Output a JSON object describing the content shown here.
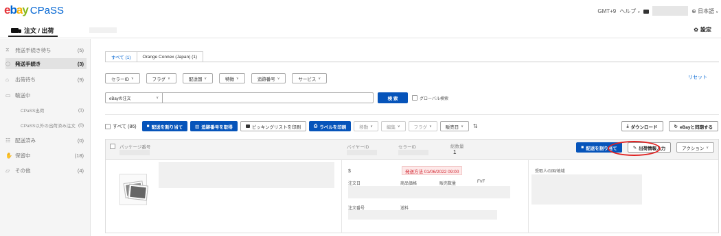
{
  "header": {
    "logo_letters": [
      "e",
      "b",
      "a",
      "y"
    ],
    "app_name": "CPaSS",
    "timezone": "GMT+9",
    "help": "ヘルプ",
    "language": "日本語"
  },
  "subheader": {
    "title": "注文 / 出荷",
    "settings": "設定"
  },
  "sidebar": {
    "items": [
      {
        "label": "発送手続き待ち",
        "count": "(5)",
        "icon": "hourglass-icon"
      },
      {
        "label": "発送手続き",
        "count": "(3)",
        "icon": "box-icon"
      },
      {
        "label": "出荷待ち",
        "count": "(9)",
        "icon": "warehouse-icon"
      },
      {
        "label": "輸送中",
        "count": "",
        "icon": "truck-icon"
      },
      {
        "label": "CPaSS出荷",
        "count": "(1)",
        "icon": ""
      },
      {
        "label": "CPaSS以外の出荷済み注文",
        "count": "(0)",
        "icon": ""
      },
      {
        "label": "配送済み",
        "count": "(0)",
        "icon": "delivered-icon"
      },
      {
        "label": "保留中",
        "count": "(18)",
        "icon": "hand-icon"
      },
      {
        "label": "その他",
        "count": "(4)",
        "icon": "folder-icon"
      }
    ]
  },
  "tabs": [
    {
      "label": "すべて (1)",
      "active": true
    },
    {
      "label": "Orange Connex (Japan) (1)",
      "active": false
    }
  ],
  "filters": [
    "セラーID",
    "フラグ",
    "配送国",
    "特徴",
    "追跡番号",
    "サービス"
  ],
  "reset": "リセット",
  "search": {
    "select_value": "eBayの注文",
    "button": "検 索",
    "global_label": "グローバル検索"
  },
  "actions": {
    "select_all": "すべて (86)",
    "assign_shipping": "配送を割り当て",
    "get_tracking": "追跡番号を取得",
    "print_picking": "ピッキングリストを印刷",
    "print_label": "ラベルを印刷",
    "move": "移動",
    "edit": "編集",
    "flag": "フラグ",
    "sales_date": "販売日",
    "download": "ダウンロード",
    "sync_ebay": "eBayと同期する"
  },
  "order": {
    "package_number_label": "パッケージ番号",
    "buyer_id_label": "バイヤーID",
    "seller_id_label": "セラーID",
    "total_qty_label": "総数量",
    "total_qty": "1",
    "assign_button": "配送を割り当て",
    "shipping_info_button": "出荷情報入力",
    "actions_button": "アクション",
    "price_symbol": "$",
    "ship_by": "発送方法 01/06/2022 09:00",
    "order_date_label": "注文日",
    "product_price_label": "商品価格",
    "sold_qty_label": "販売数量",
    "fvf_label": "FVF",
    "order_number_label": "注文番号",
    "shipping_fee_label": "送料",
    "recipient_label": "受取人の国/地域"
  },
  "colors": {
    "primary": "#0654ba",
    "link": "#0064d2",
    "highlight_ring": "#e02020",
    "warn": "#d1242f"
  }
}
